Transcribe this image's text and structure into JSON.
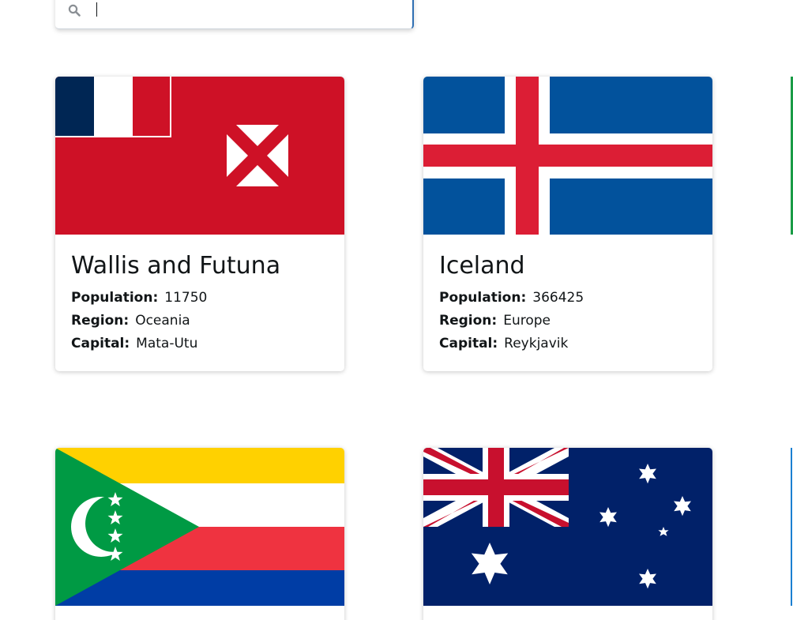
{
  "search": {
    "value": "",
    "placeholder": ""
  },
  "labels": {
    "population": "Population:",
    "region": "Region:",
    "capital": "Capital:"
  },
  "countries": [
    {
      "name": "Wallis and Futuna",
      "population": "11750",
      "region": "Oceania",
      "capital": "Mata-Utu",
      "flag": "wallis-and-futuna-flag"
    },
    {
      "name": "Iceland",
      "population": "366425",
      "region": "Europe",
      "capital": "Reykjavik",
      "flag": "iceland-flag"
    },
    {
      "name": "",
      "population": "",
      "region": "",
      "capital": "",
      "flag": "comoros-flag"
    },
    {
      "name": "",
      "population": "",
      "region": "",
      "capital": "",
      "flag": "australia-flag"
    }
  ],
  "colors": {
    "text": "#111517",
    "background": "#ffffff",
    "focus_border": "#2f6fb3"
  }
}
